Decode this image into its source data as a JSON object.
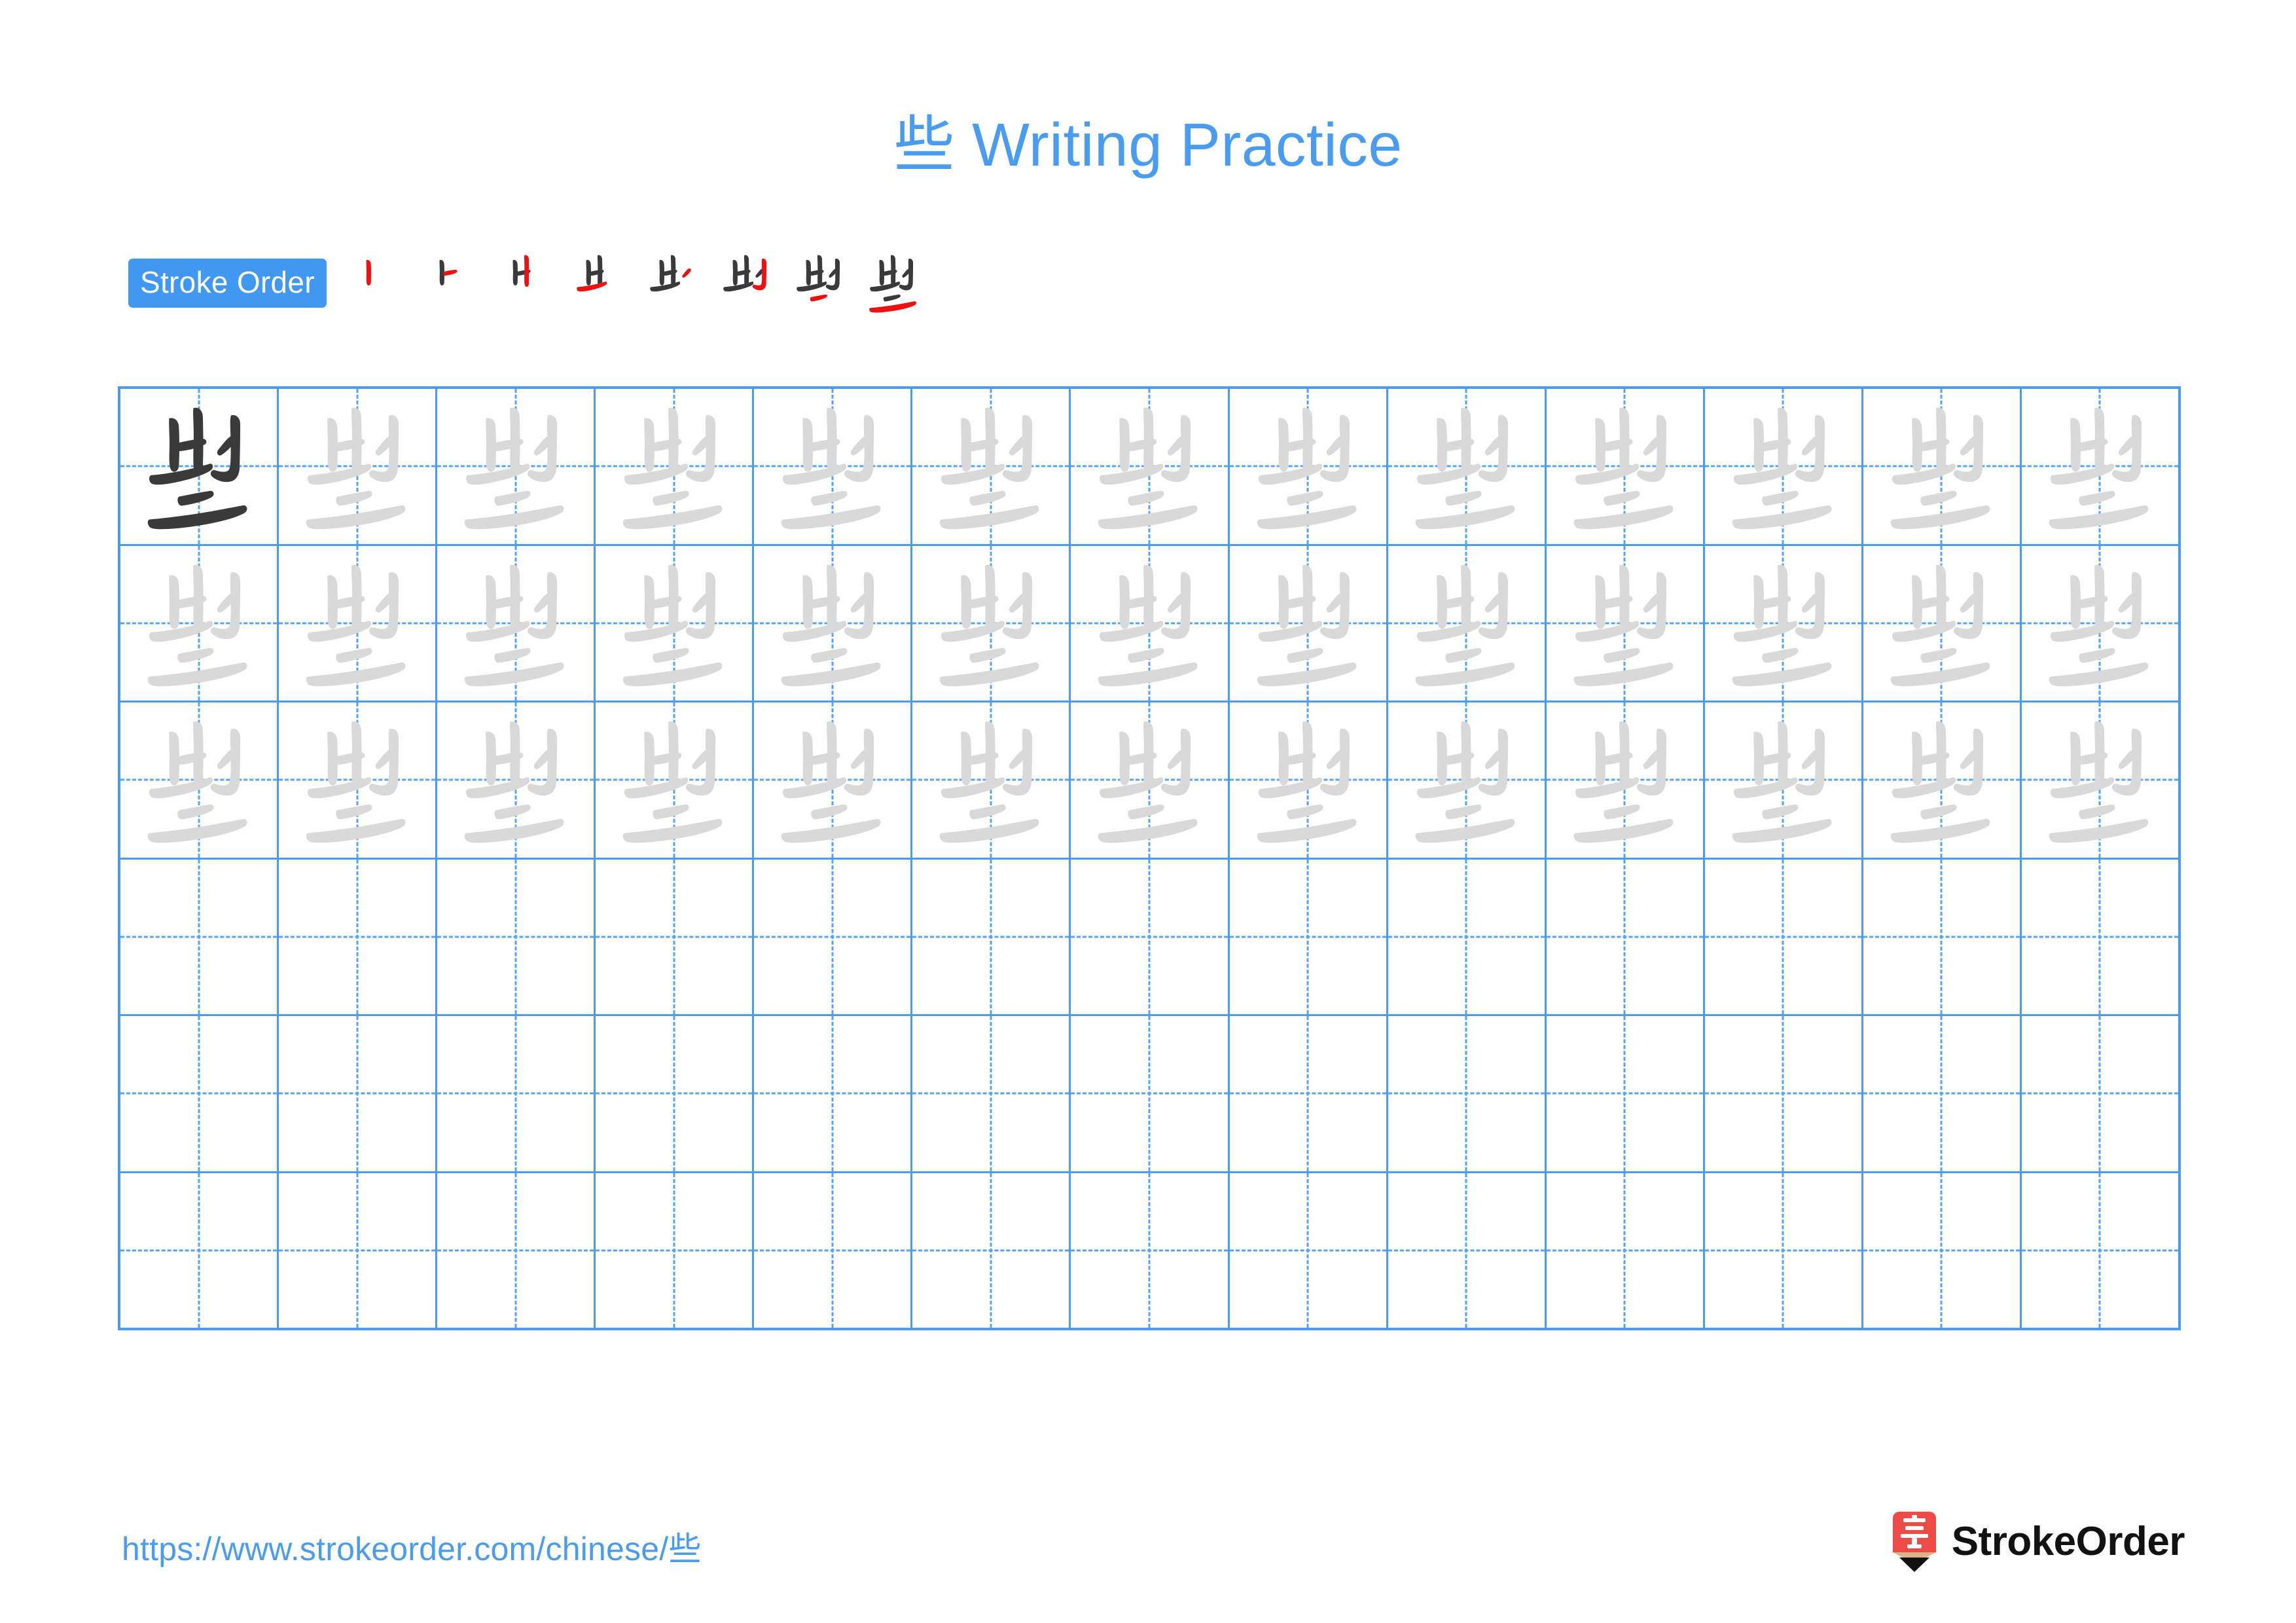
{
  "page": {
    "character": "些",
    "title": "些 Writing Practice",
    "title_prefix_char": "些",
    "title_text": " Writing Practice",
    "accent_color": "#4a9cf0",
    "badge_color": "#4098f0",
    "ink_color": "#3a3a3a",
    "trace_color": "#d9d9d9",
    "highlight_color": "#ee1111"
  },
  "stroke_order": {
    "badge_label": "Stroke Order",
    "stroke_count": 8,
    "steps": [
      {
        "index": 1,
        "name": "stroke-step-1",
        "new_stroke": 1
      },
      {
        "index": 2,
        "name": "stroke-step-2",
        "new_stroke": 2
      },
      {
        "index": 3,
        "name": "stroke-step-3",
        "new_stroke": 3
      },
      {
        "index": 4,
        "name": "stroke-step-4",
        "new_stroke": 4
      },
      {
        "index": 5,
        "name": "stroke-step-5",
        "new_stroke": 5
      },
      {
        "index": 6,
        "name": "stroke-step-6",
        "new_stroke": 6
      },
      {
        "index": 7,
        "name": "stroke-step-7",
        "new_stroke": 7
      },
      {
        "index": 8,
        "name": "stroke-step-8",
        "new_stroke": 8
      }
    ]
  },
  "grid": {
    "columns": 13,
    "rows": 6,
    "rows_content": [
      {
        "row": 1,
        "filled_cells": 13,
        "first_cell_style": "ink",
        "other_cells_style": "trace"
      },
      {
        "row": 2,
        "filled_cells": 13,
        "first_cell_style": "trace",
        "other_cells_style": "trace"
      },
      {
        "row": 3,
        "filled_cells": 13,
        "first_cell_style": "trace",
        "other_cells_style": "trace"
      },
      {
        "row": 4,
        "filled_cells": 0,
        "first_cell_style": "empty",
        "other_cells_style": "empty"
      },
      {
        "row": 5,
        "filled_cells": 0,
        "first_cell_style": "empty",
        "other_cells_style": "empty"
      },
      {
        "row": 6,
        "filled_cells": 0,
        "first_cell_style": "empty",
        "other_cells_style": "empty"
      }
    ]
  },
  "footer": {
    "url_text": "https://www.strokeorder.com/chinese/",
    "url_char": "些",
    "brand_name": "StrokeOrder",
    "brand_mark_char": "字",
    "brand_mark_color": "#ee4a46",
    "brand_mark_tip_color": "#dcb48c"
  }
}
